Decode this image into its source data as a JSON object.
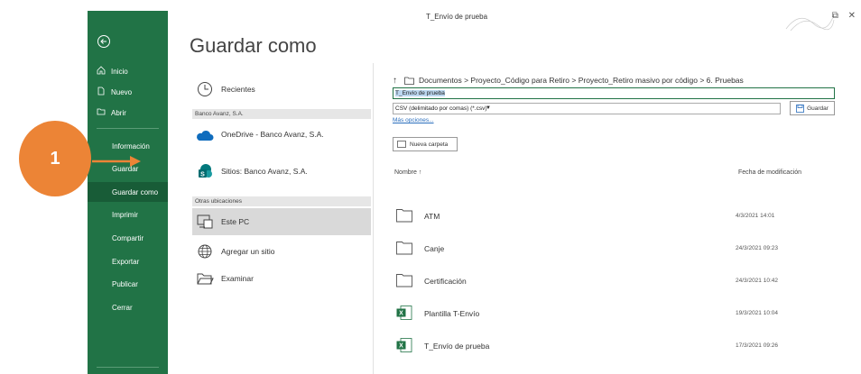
{
  "window": {
    "title": "T_Envío de prueba"
  },
  "sidebar": {
    "items": [
      {
        "label": "Inicio"
      },
      {
        "label": "Nuevo"
      },
      {
        "label": "Abrir"
      },
      {
        "label": "Información"
      },
      {
        "label": "Guardar"
      },
      {
        "label": "Guardar como"
      },
      {
        "label": "Imprimir"
      },
      {
        "label": "Compartir"
      },
      {
        "label": "Exportar"
      },
      {
        "label": "Publicar"
      },
      {
        "label": "Cerrar"
      }
    ]
  },
  "page": {
    "title": "Guardar como"
  },
  "locations": {
    "recent": "Recientes",
    "group1": "Banco Avanz, S.A.",
    "onedrive": "OneDrive - Banco Avanz, S.A.",
    "sites": "Sitios: Banco Avanz, S.A.",
    "group2": "Otras ubicaciones",
    "thispc": "Este PC",
    "addsite": "Agregar un sitio",
    "browse": "Examinar"
  },
  "file": {
    "path": "Documentos > Proyecto_Código para Retiro > Proyecto_Retiro masivo por código > 6. Pruebas",
    "name_value": "T_Envio de prueba",
    "type_value": "CSV (delimitado por comas) (*.csv)",
    "save_label": "Guardar",
    "more_options": "Más opciones...",
    "new_folder": "Nueva carpeta",
    "col_name": "Nombre ↑",
    "col_date": "Fecha de modificación",
    "rows": [
      {
        "name": "ATM",
        "date": "4/3/2021 14:01",
        "kind": "folder"
      },
      {
        "name": "Canje",
        "date": "24/3/2021 09:23",
        "kind": "folder"
      },
      {
        "name": "Certificación",
        "date": "24/3/2021 10:42",
        "kind": "folder"
      },
      {
        "name": "Plantilla T-Envío",
        "date": "19/3/2021 10:04",
        "kind": "excel"
      },
      {
        "name": "T_Envío de prueba",
        "date": "17/3/2021 09:26",
        "kind": "excel"
      }
    ]
  },
  "annotation": {
    "step": "1"
  },
  "colors": {
    "sidebar": "#217346",
    "accent": "#ec8436"
  }
}
